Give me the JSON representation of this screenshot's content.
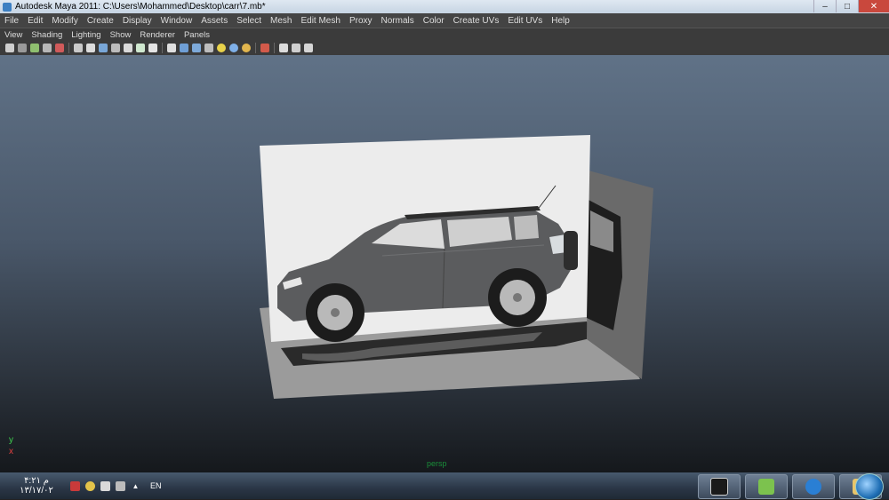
{
  "window": {
    "title": "Autodesk Maya 2011: C:\\Users\\Mohammed\\Desktop\\carr\\7.mb*"
  },
  "menubar": [
    "File",
    "Edit",
    "Modify",
    "Create",
    "Display",
    "Window",
    "Assets",
    "Select",
    "Mesh",
    "Edit Mesh",
    "Proxy",
    "Normals",
    "Color",
    "Create UVs",
    "Edit UVs",
    "Help"
  ],
  "panel_menu": [
    "View",
    "Shading",
    "Lighting",
    "Show",
    "Renderer",
    "Panels"
  ],
  "viewport": {
    "camera_label": "persp",
    "axis_y": "y",
    "axis_x": "x"
  },
  "taskbar": {
    "time": "۴:۲۱ م",
    "date": "۱۳/۱۷/۰۲",
    "language": "EN"
  },
  "icons": {
    "window_controls": [
      "minimize-icon",
      "maximize-icon",
      "close-icon"
    ],
    "tray": [
      "network-error-icon",
      "action-center-icon",
      "volume-icon",
      "usb-icon",
      "tray-expand-icon"
    ],
    "taskbar_apps": [
      "maya-icon",
      "paint-icon",
      "maxthon-icon",
      "folder-icon"
    ],
    "start": "windows-start-icon"
  },
  "colors": {
    "menubar_bg": "#444444",
    "viewport_top": "#607287",
    "camera_label": "#1a8f3a"
  }
}
